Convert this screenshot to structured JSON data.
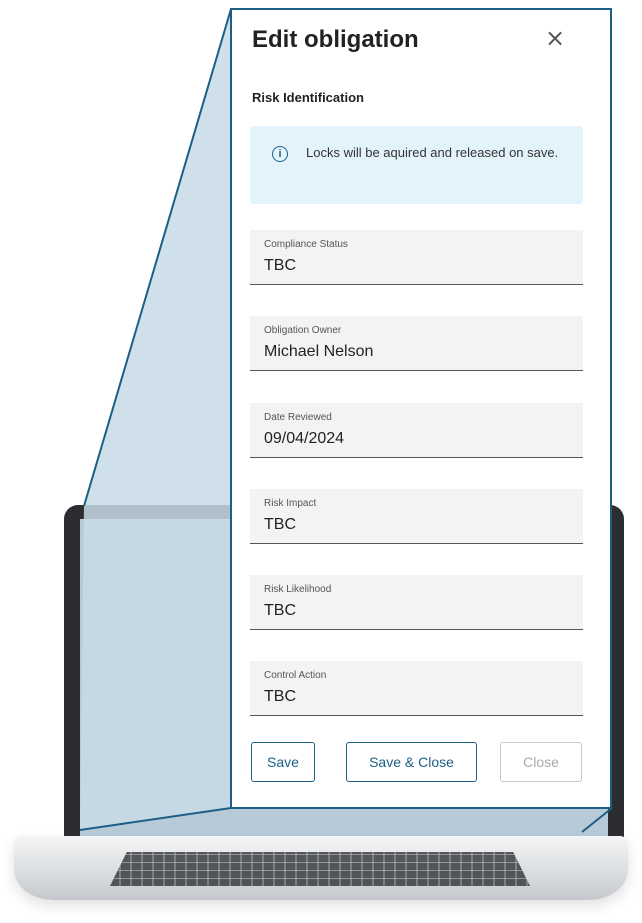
{
  "panel": {
    "title": "Edit obligation",
    "close_icon": "×",
    "section_label": "Risk Identification",
    "info": {
      "icon": "i",
      "text": "Locks will be aquired and released on save."
    },
    "fields": [
      {
        "label": "Compliance Status",
        "value": "TBC"
      },
      {
        "label": "Obligation Owner",
        "value": "Michael Nelson"
      },
      {
        "label": "Date Reviewed",
        "value": "09/04/2024"
      },
      {
        "label": "Risk Impact",
        "value": "TBC"
      },
      {
        "label": "Risk Likelihood",
        "value": "TBC"
      },
      {
        "label": "Control Action",
        "value": "TBC"
      }
    ],
    "buttons": {
      "save": "Save",
      "save_close": "Save & Close",
      "close": "Close"
    }
  },
  "colors": {
    "accent": "#1c5f86",
    "info_bg": "#e3f3fb",
    "field_bg": "#f3f3f3"
  }
}
